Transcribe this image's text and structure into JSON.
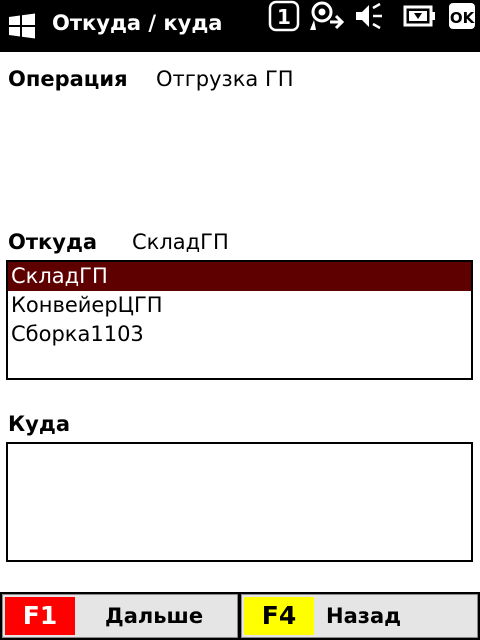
{
  "titlebar": {
    "title": "Откуда / куда",
    "icons": [
      "windows-logo-icon",
      "notification-count-icon",
      "connectivity-icon",
      "speaker-icon",
      "battery-icon",
      "ok-icon"
    ],
    "notification_count": "1",
    "ok_label": "OK"
  },
  "operation": {
    "label": "Операция",
    "value": "Отгрузка ГП"
  },
  "from": {
    "label": "Откуда",
    "value": "СкладГП",
    "items": [
      {
        "label": "СкладГП",
        "selected": true
      },
      {
        "label": "КонвейерЦГП",
        "selected": false
      },
      {
        "label": "Сборка1103",
        "selected": false
      }
    ]
  },
  "to": {
    "label": "Куда",
    "items": []
  },
  "fkeys": [
    {
      "key": "F1",
      "label": "Дальше",
      "badge_color": "#ff0000",
      "badge_text_color": "#ffffff"
    },
    {
      "key": "F4",
      "label": "Назад",
      "badge_color": "#ffff00",
      "badge_text_color": "#000000"
    }
  ],
  "colors": {
    "titlebar_bg": "#000000",
    "selection_bg": "#5e0000",
    "fkey_bg": "#e5e5e5"
  }
}
